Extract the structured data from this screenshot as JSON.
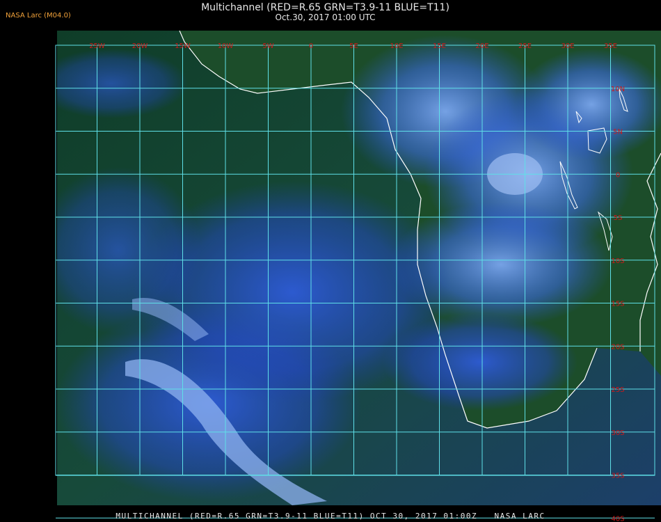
{
  "header": {
    "credit": "NASA Larc (M04.0)",
    "title": "Multichannel (RED=R.65 GRN=T3.9-11 BLUE=T11)",
    "subtitle": "Oct.30, 2017 01:00 UTC"
  },
  "footer": {
    "caption": "MULTICHANNEL (RED=R.65 GRN=T3.9-11 BLUE=T11) OCT 30, 2017 01:00Z   NASA LARC"
  },
  "map": {
    "lon_labels": [
      "25W",
      "20W",
      "15W",
      "10W",
      "5W",
      "0",
      "5E",
      "10E",
      "15E",
      "20E",
      "25E",
      "30E",
      "35E"
    ],
    "lon_values": [
      -25,
      -20,
      -15,
      -10,
      -5,
      0,
      5,
      10,
      15,
      20,
      25,
      30,
      35
    ],
    "lat_labels": [
      "10N",
      "5N",
      "0",
      "5S",
      "10S",
      "15S",
      "20S",
      "25S",
      "30S",
      "35S",
      "40S"
    ],
    "lat_values": [
      10,
      5,
      0,
      -5,
      -10,
      -15,
      -20,
      -25,
      -30,
      -35,
      -40
    ],
    "lon_range": [
      -28,
      35
    ],
    "lat_range": [
      -40,
      15
    ],
    "colors": {
      "grid": "#5fe0e8",
      "label": "#d01818",
      "coast": "#ffffff",
      "ocean": "#123f2c",
      "land": "#1b4a2a",
      "cloud_low": "#2a56d8",
      "cloud_high": "#7aa6ee",
      "credit": "#f2a23a",
      "text": "#e8e8e8"
    }
  }
}
